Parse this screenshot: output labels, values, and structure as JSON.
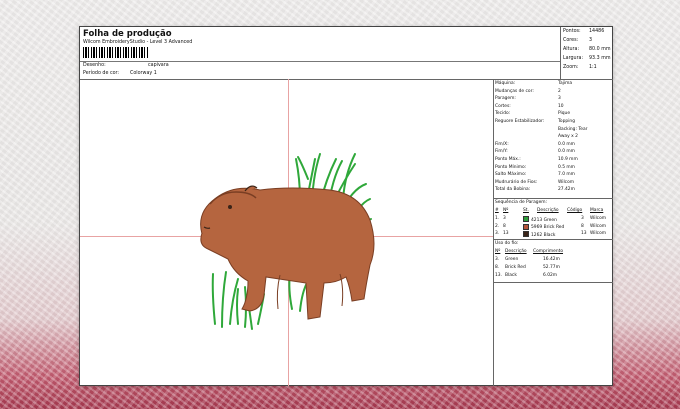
{
  "header": {
    "title": "Folha de produção",
    "subtitle": "Wilcom EmbroideryStudio - Level 3 Advanced",
    "design_label": "Desenho:",
    "design_value": "capivara",
    "period_label": "Período de cor:",
    "period_value": "Colorway 1"
  },
  "stats": [
    {
      "label": "Pontos:",
      "value": "14486"
    },
    {
      "label": "Cores:",
      "value": "3"
    },
    {
      "label": "Altura:",
      "value": "80.0 mm"
    },
    {
      "label": "Largura:",
      "value": "93.3 mm"
    },
    {
      "label": "Zoom:",
      "value": "1:1"
    }
  ],
  "machine": [
    {
      "label": "Máquina:",
      "value": "Tajima"
    },
    {
      "label": "Mudanças de cor:",
      "value": "2"
    },
    {
      "label": "Paragem:",
      "value": "3"
    },
    {
      "label": "Cortes:",
      "value": "10"
    },
    {
      "label": "Tecido:",
      "value": "Pique"
    },
    {
      "label": "Reguore Estabilizador:",
      "value": "Topping"
    },
    {
      "label": "",
      "value": "Backing: Tear"
    },
    {
      "label": "",
      "value": "Away x 2"
    },
    {
      "label": "Fim/X:",
      "value": "0.0 mm"
    },
    {
      "label": "Fim/Y:",
      "value": "0.0 mm"
    },
    {
      "label": "Ponto Máx.:",
      "value": "10.9 mm"
    },
    {
      "label": "Ponto Mínimo:",
      "value": "0.5 mm"
    },
    {
      "label": "Salto Máximo:",
      "value": "7.0 mm"
    },
    {
      "label": "Mudrurário de Fios:",
      "value": "Wilcom"
    },
    {
      "label": "Total da Bobina:",
      "value": "27.42m"
    }
  ],
  "stop_sequence": {
    "title": "Sequência de Paragem:",
    "headers": [
      "#",
      "Nº",
      "St.",
      "Descrição",
      "Código",
      "Marca"
    ],
    "rows": [
      {
        "n": "1.",
        "code_num": "3",
        "color": "#2e9e3a",
        "desc": "4213 Green",
        "code": "3",
        "brand": "Wilcom"
      },
      {
        "n": "2.",
        "code_num": "8",
        "color": "#b5543a",
        "desc": "5969 Brick Red",
        "code": "8",
        "brand": "Wilcom"
      },
      {
        "n": "3.",
        "code_num": "13",
        "color": "#3a2418",
        "desc": "1262 Black",
        "code": "13",
        "brand": "Wilcom"
      }
    ]
  },
  "thread_usage": {
    "title": "Uso do fio:",
    "headers": [
      "Nº",
      "Descrição",
      "Comprimento"
    ],
    "rows": [
      {
        "n": "3.",
        "desc": "Green",
        "length": "16.42m"
      },
      {
        "n": "8.",
        "desc": "Brick Red",
        "length": "52.77m"
      },
      {
        "n": "13.",
        "desc": "Black",
        "length": "6.02m"
      }
    ]
  },
  "colors": {
    "grass": "#2fa83a",
    "capybara": "#b5653f",
    "dark": "#3a2418",
    "crosshair": "#e8a3a3"
  }
}
